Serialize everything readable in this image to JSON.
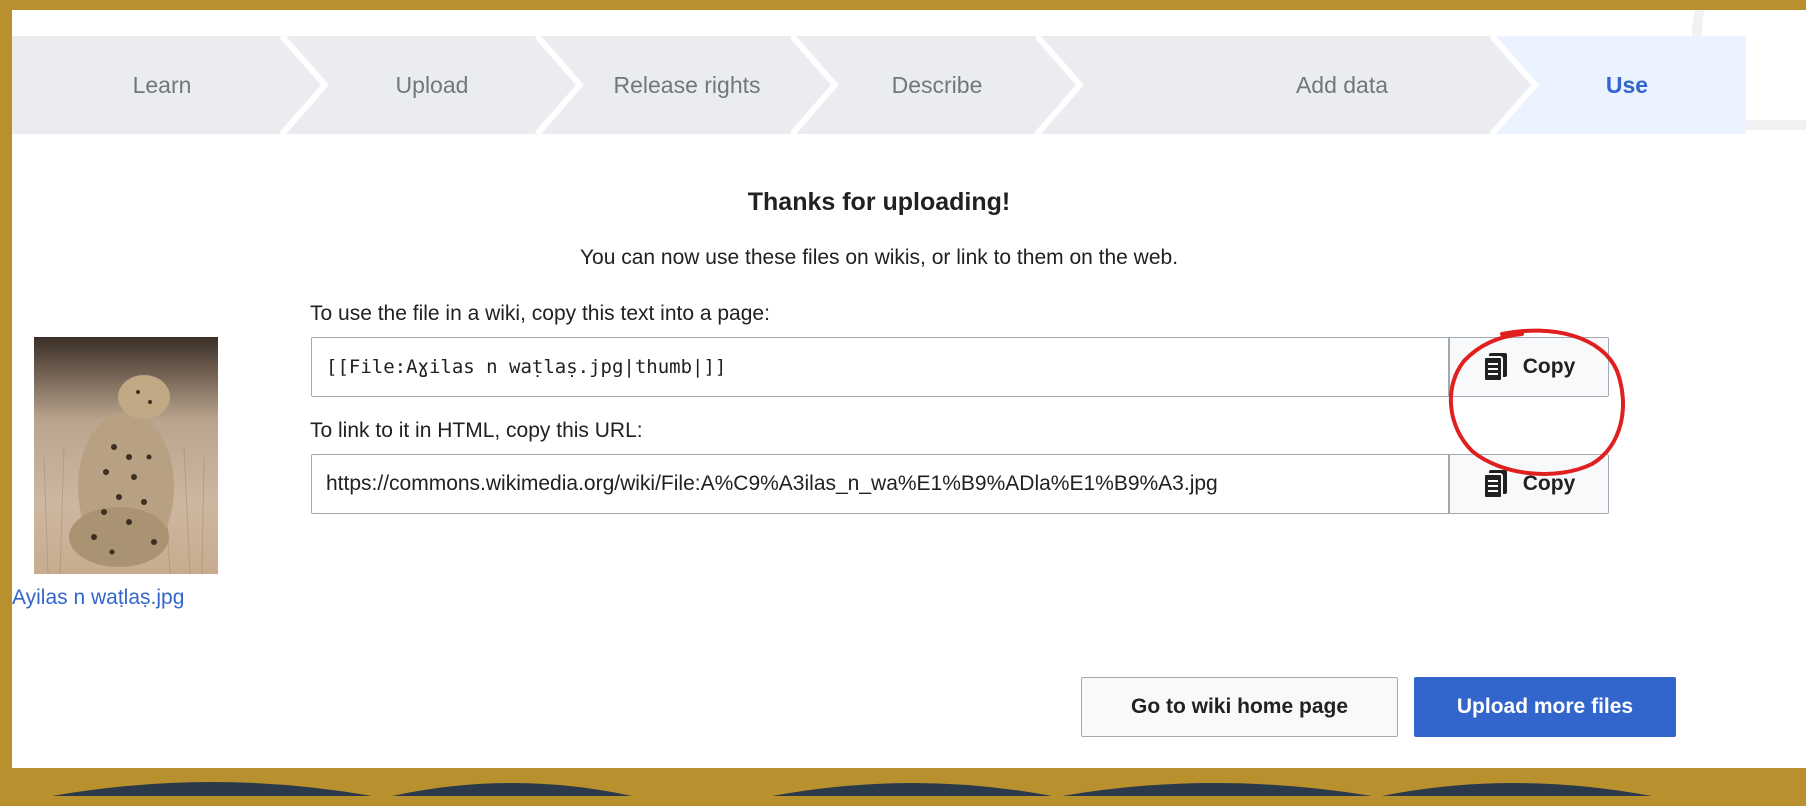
{
  "steps": [
    {
      "label": "Learn"
    },
    {
      "label": "Upload"
    },
    {
      "label": "Release rights"
    },
    {
      "label": "Describe"
    },
    {
      "label": "Add data"
    },
    {
      "label": "Use"
    }
  ],
  "heading": "Thanks for uploading!",
  "subheading": "You can now use these files on wikis, or link to them on the web.",
  "file": {
    "caption": "Ayilas n waṭlaṣ.jpg"
  },
  "wiki_use": {
    "label": "To use the file in a wiki, copy this text into a page:",
    "value": "[[File:Aɣilas n waṭlaṣ.jpg|thumb|]]",
    "copy_label": "Copy"
  },
  "html_link": {
    "label": "To link to it in HTML, copy this URL:",
    "value": "https://commons.wikimedia.org/wiki/File:A%C9%A3ilas_n_wa%E1%B9%ADla%E1%B9%A3.jpg",
    "copy_label": "Copy"
  },
  "actions": {
    "home_label": "Go to wiki home page",
    "more_label": "Upload more files"
  },
  "colors": {
    "frame": "#b8912e",
    "accent": "#3366cc",
    "annotation": "#e02020"
  },
  "icons": {
    "copy": "clipboard-icon"
  }
}
